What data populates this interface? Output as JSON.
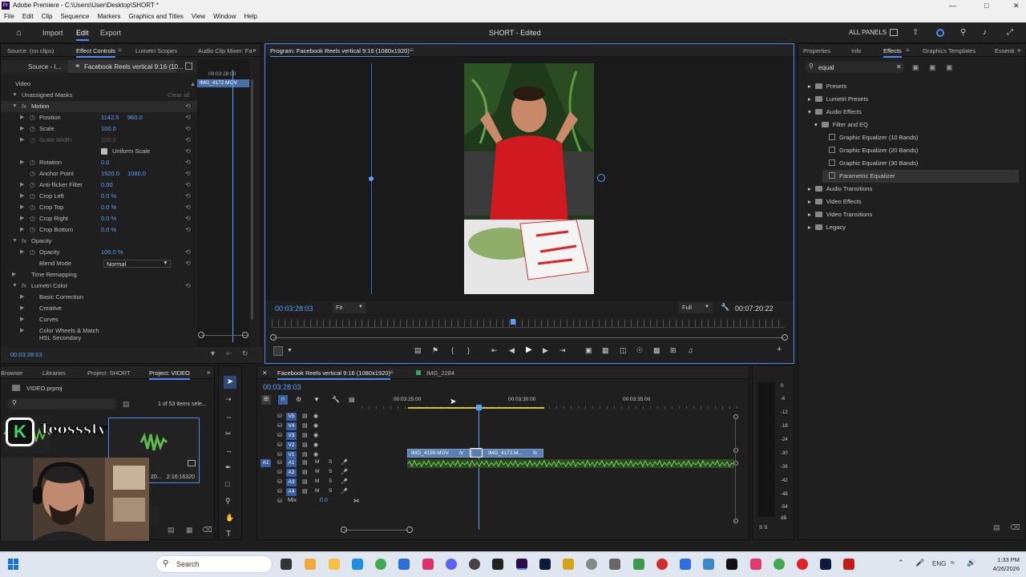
{
  "window": {
    "title": "Adobe Premiere - C:\\Users\\User\\Desktop\\SHORT *",
    "logo": "Pr"
  },
  "menu": [
    "File",
    "Edit",
    "Clip",
    "Sequence",
    "Markers",
    "Graphics and Titles",
    "View",
    "Window",
    "Help"
  ],
  "header": {
    "nav": {
      "import": "Import",
      "edit": "Edit",
      "export": "Export"
    },
    "project_title": "SHORT - Edited",
    "all_panels": "ALL PANELS"
  },
  "left_panel": {
    "tabs": {
      "source": "Source: (no clips)",
      "effect_controls": "Effect Controls",
      "lumetri_scopes": "Lumetri Scopes",
      "audio_mixer": "Audio Clip Mixer: Fa"
    },
    "source_label": "Source - I...",
    "sequence_label": "Facebook Reels vertical 9:16 (10...",
    "mini_timecode": "00:03:28:00",
    "mini_clip": "IMG_4172.MOV",
    "video_heading": "Video",
    "clear_all": "Clear all",
    "rows": {
      "masks": "Unassigned Masks",
      "motion": "Motion",
      "position": "Position",
      "position_x": "1142.5",
      "position_y": "960.0",
      "scale": "Scale",
      "scale_val": "100.0",
      "scale_width": "Scale Width",
      "scale_width_val": "100.0",
      "uniform_scale": "Uniform Scale",
      "rotation": "Rotation",
      "rotation_val": "0.0",
      "anchor": "Anchor Point",
      "anchor_x": "1920.0",
      "anchor_y": "1080.0",
      "antiflicker": "Anti-flicker Filter",
      "antiflicker_val": "0.00",
      "crop_left": "Crop Left",
      "crop_left_val": "0.0 %",
      "crop_top": "Crop Top",
      "crop_top_val": "0.0 %",
      "crop_right": "Crop Right",
      "crop_right_val": "0.0 %",
      "crop_bottom": "Crop Bottom",
      "crop_bottom_val": "0.0 %",
      "opacity_group": "Opacity",
      "opacity": "Opacity",
      "opacity_val": "100.0 %",
      "blend_mode": "Blend Mode",
      "blend_mode_val": "Normal",
      "time_remapping": "Time Remapping",
      "lumetri": "Lumetri Color",
      "basic": "Basic Correction",
      "creative": "Creative",
      "curves": "Curves",
      "wheels": "Color Wheels & Match",
      "hsl": "HSL Secondary"
    },
    "timecode": "00:03:28:03"
  },
  "program": {
    "title": "Program: Facebook Reels vertical 9:16 (1080x1920)",
    "timecode": "00:03:28:03",
    "fit": "Fit",
    "quality": "Full",
    "duration": "00:07:20:22"
  },
  "right_panel": {
    "tabs": {
      "properties": "Properties",
      "info": "Info",
      "effects": "Effects",
      "graphics": "Graphics Templates",
      "essential": "Essenti"
    },
    "search_value": "equal",
    "tree": {
      "presets": "Presets",
      "lumetri_presets": "Lumetri Presets",
      "audio_effects": "Audio Effects",
      "filter_eq": "Filter and EQ",
      "geq10": "Graphic Equalizer (10 Bands)",
      "geq20": "Graphic Equalizer (20 Bands)",
      "geq30": "Graphic Equalizer (30 Bands)",
      "parametric": "Parametric Equalizer",
      "audio_transitions": "Audio Transitions",
      "video_effects": "Video Effects",
      "video_transitions": "Video Transitions",
      "legacy": "Legacy"
    }
  },
  "project_panel": {
    "tabs": {
      "browser": "Browser",
      "libraries": "Libraries",
      "project_short": "Project: SHORT",
      "project_video": "Project: VIDEO"
    },
    "file": "VIDEO.prproj",
    "items_count": "1 of 53 items sele...",
    "thumb_caption": "20...",
    "thumb_duration": "2:16:16320",
    "watermark": "Teosssty",
    "watermark_k": "K"
  },
  "timeline": {
    "tabs": {
      "sequence": "Facebook Reels vertical 9:16 (1080x1920)",
      "img": "IMG_2284"
    },
    "timecode": "00:03:28:03",
    "ruler": [
      "00:03:25:00",
      "00:03:30:00",
      "00:03:35:00"
    ],
    "video_tracks": [
      "V5",
      "V4",
      "V3",
      "V2",
      "V1"
    ],
    "audio_tracks": [
      "A1",
      "A2",
      "A3",
      "A4"
    ],
    "clips": {
      "clip1": "IMG_4198.MOV",
      "clip2": "IMG_4172.M..."
    },
    "mix_label": "Mix",
    "mix_value": "0.0",
    "fx_label": "fx"
  },
  "meter": {
    "scale": [
      "0",
      "-6",
      "-12",
      "-18",
      "-24",
      "-30",
      "-36",
      "-42",
      "-48",
      "-54",
      "dB"
    ],
    "solo": "S S"
  },
  "taskbar": {
    "search": "Search",
    "lang": "ENG",
    "time": "1:33 PM",
    "date": "4/26/2026"
  },
  "colors": {
    "accent": "#4c8bf5",
    "playhead": "#5aa0ff",
    "clip_video": "#5b7fb2",
    "audio_wave": "#5fb84a"
  }
}
